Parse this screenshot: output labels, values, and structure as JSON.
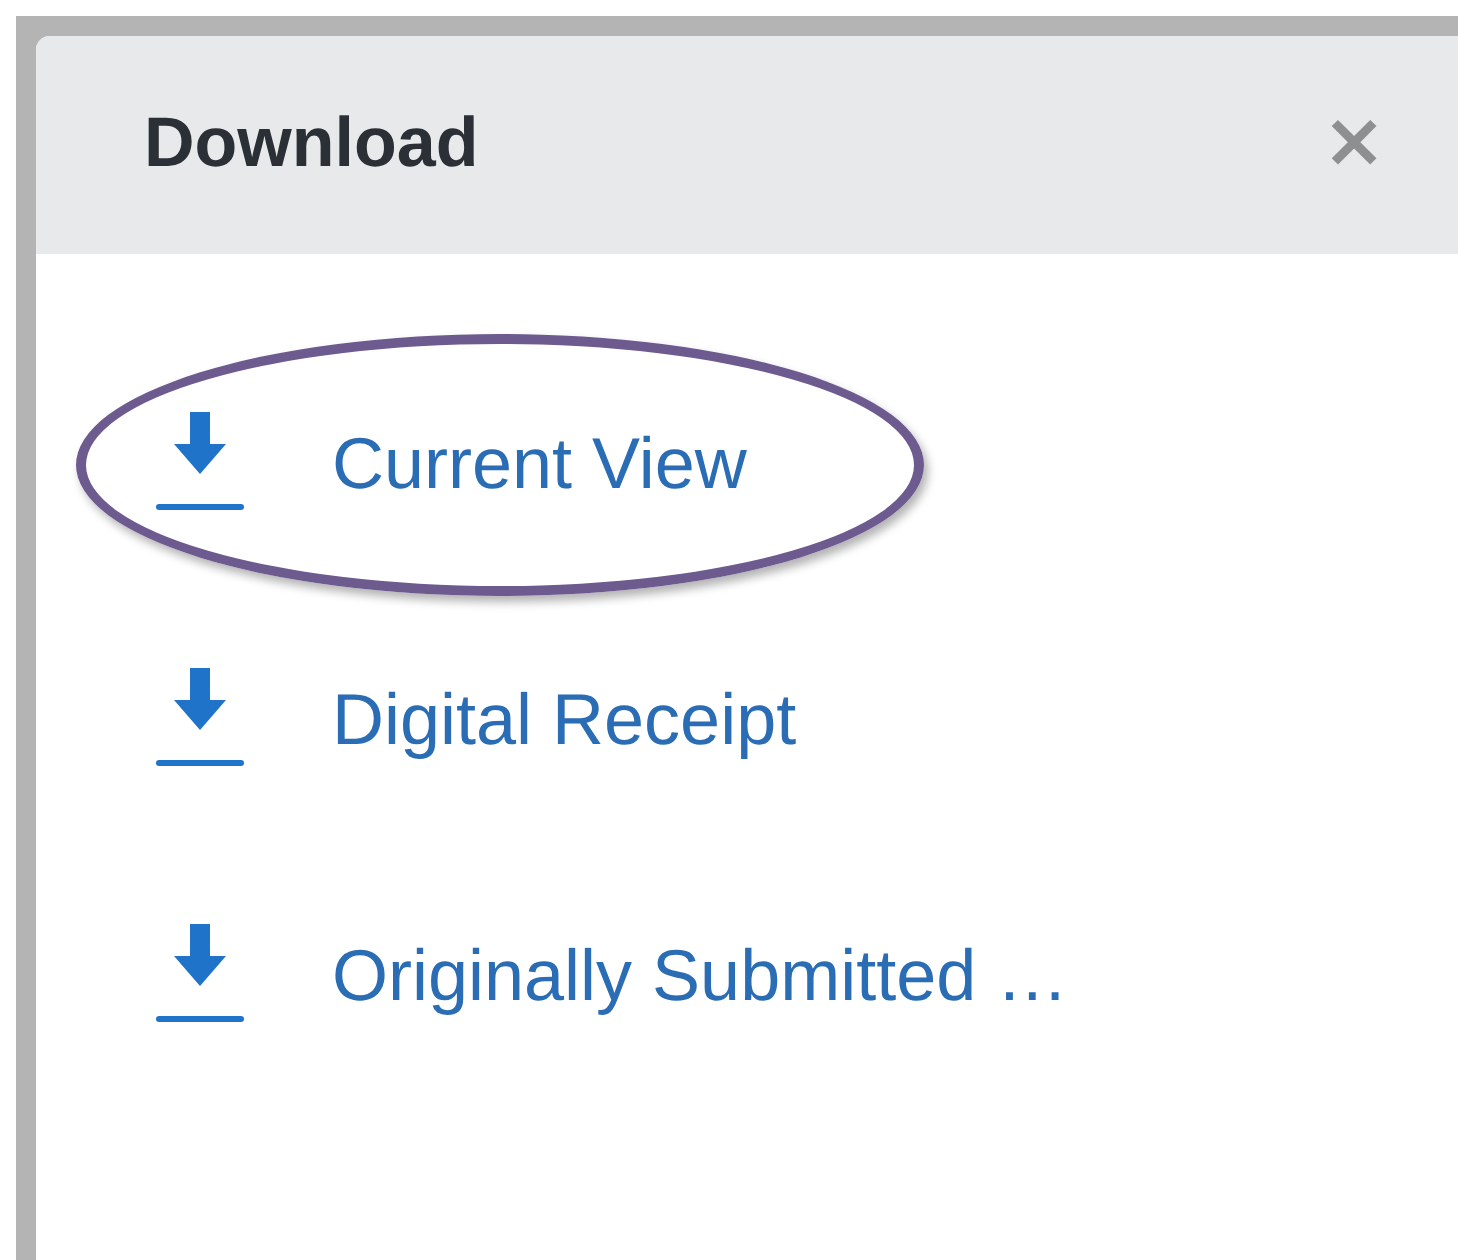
{
  "dialog": {
    "title": "Download",
    "close": "×"
  },
  "items": [
    {
      "label": "Current View",
      "highlighted": true
    },
    {
      "label": "Digital Receipt",
      "highlighted": false
    },
    {
      "label": "Originally Submitted …",
      "highlighted": false
    }
  ]
}
